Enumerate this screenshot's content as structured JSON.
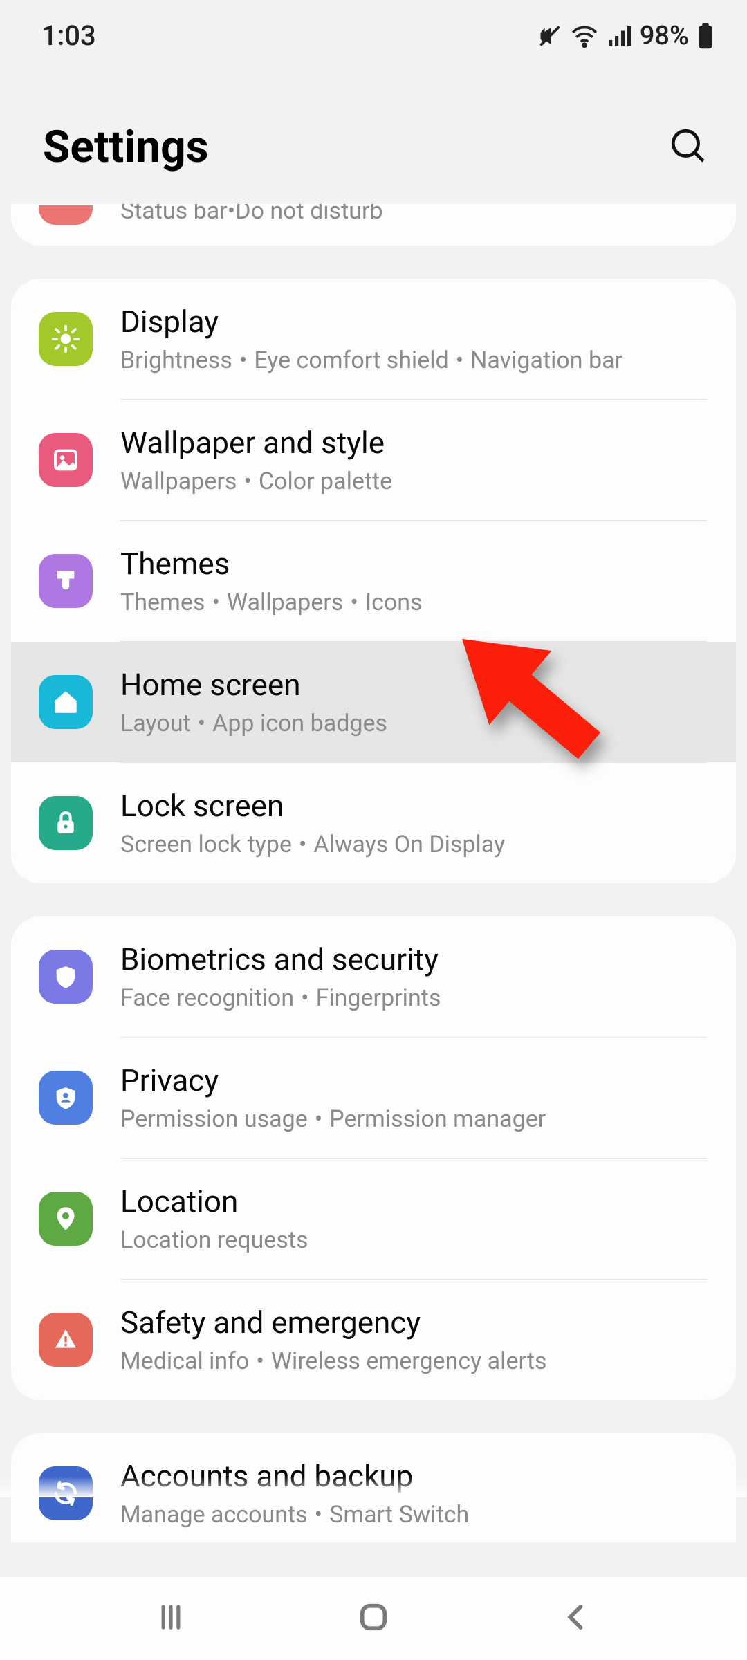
{
  "status_bar": {
    "time": "1:03",
    "battery": "98%"
  },
  "header": {
    "title": "Settings"
  },
  "partial_top": {
    "subtitle_parts": [
      "Status bar",
      "Do not disturb"
    ]
  },
  "groups": [
    {
      "items": [
        {
          "id": "display",
          "title": "Display",
          "subtitle_parts": [
            "Brightness",
            "Eye comfort shield",
            "Navigation bar"
          ],
          "icon_bg": "#a1c92a",
          "icon": "sun",
          "highlight": false
        },
        {
          "id": "wallpaper",
          "title": "Wallpaper and style",
          "subtitle_parts": [
            "Wallpapers",
            "Color palette"
          ],
          "icon_bg": "#ea5a7d",
          "icon": "picture",
          "highlight": false
        },
        {
          "id": "themes",
          "title": "Themes",
          "subtitle_parts": [
            "Themes",
            "Wallpapers",
            "Icons"
          ],
          "icon_bg": "#ae77e1",
          "icon": "brush",
          "highlight": false
        },
        {
          "id": "home-screen",
          "title": "Home screen",
          "subtitle_parts": [
            "Layout",
            "App icon badges"
          ],
          "icon_bg": "#19b7d8",
          "icon": "home",
          "highlight": true
        },
        {
          "id": "lock-screen",
          "title": "Lock screen",
          "subtitle_parts": [
            "Screen lock type",
            "Always On Display"
          ],
          "icon_bg": "#27a98c",
          "icon": "lock",
          "highlight": false
        }
      ]
    },
    {
      "items": [
        {
          "id": "biometrics",
          "title": "Biometrics and security",
          "subtitle_parts": [
            "Face recognition",
            "Fingerprints"
          ],
          "icon_bg": "#7a79e6",
          "icon": "shield",
          "highlight": false
        },
        {
          "id": "privacy",
          "title": "Privacy",
          "subtitle_parts": [
            "Permission usage",
            "Permission manager"
          ],
          "icon_bg": "#4f7fe1",
          "icon": "shield-person",
          "highlight": false
        },
        {
          "id": "location",
          "title": "Location",
          "subtitle_parts": [
            "Location requests"
          ],
          "icon_bg": "#5fa944",
          "icon": "pin",
          "highlight": false
        },
        {
          "id": "safety",
          "title": "Safety and emergency",
          "subtitle_parts": [
            "Medical info",
            "Wireless emergency alerts"
          ],
          "icon_bg": "#e5695b",
          "icon": "alert",
          "highlight": false
        }
      ]
    },
    {
      "items": [
        {
          "id": "accounts-backup",
          "title": "Accounts and backup",
          "subtitle_parts": [
            "Manage accounts",
            "Smart Switch"
          ],
          "icon_bg": "#3e66cb",
          "icon": "sync",
          "highlight": false
        }
      ]
    }
  ]
}
